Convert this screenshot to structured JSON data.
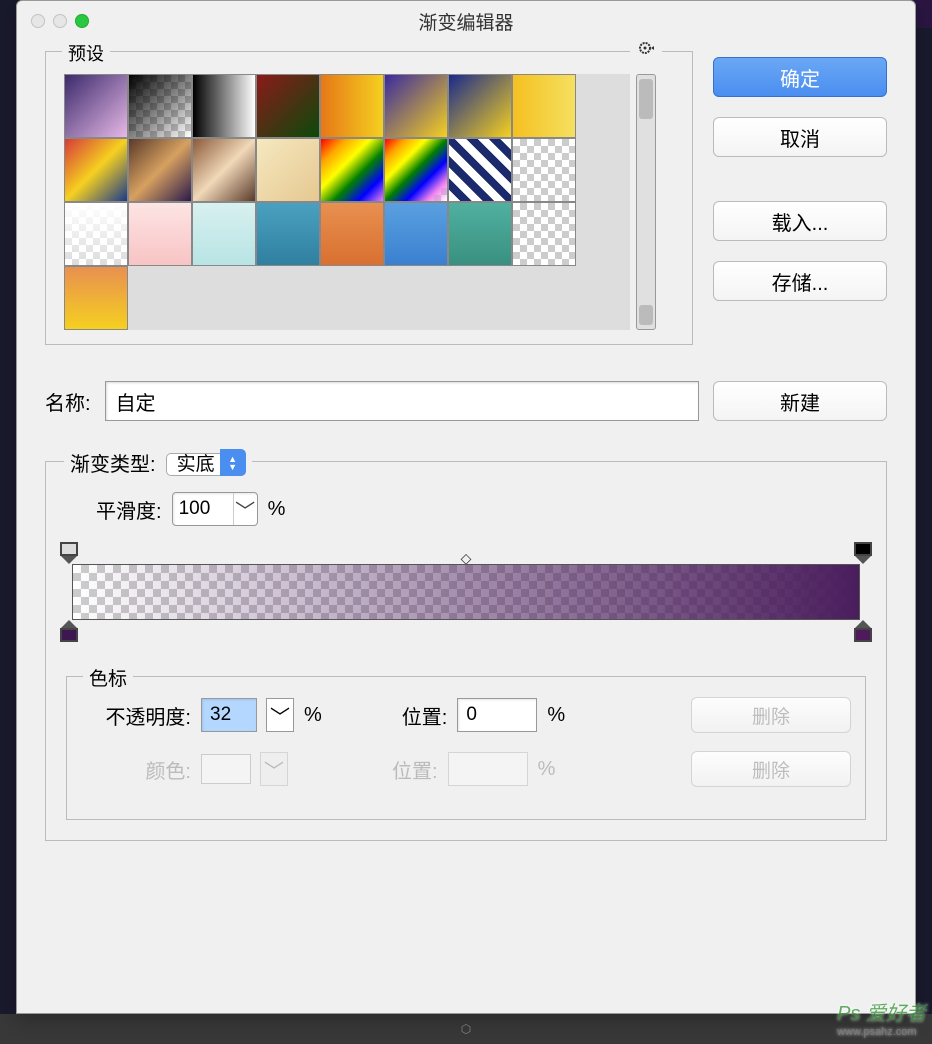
{
  "window": {
    "title": "渐变编辑器"
  },
  "presets": {
    "label": "预设"
  },
  "buttons": {
    "ok": "确定",
    "cancel": "取消",
    "load": "载入...",
    "save": "存储...",
    "new": "新建"
  },
  "name": {
    "label": "名称:",
    "value": "自定"
  },
  "gradient_type": {
    "label": "渐变类型:",
    "value": "实底"
  },
  "smoothness": {
    "label": "平滑度:",
    "value": "100",
    "unit": "%"
  },
  "stops": {
    "label": "色标",
    "opacity": {
      "label": "不透明度:",
      "value": "32",
      "unit": "%"
    },
    "position1": {
      "label": "位置:",
      "value": "0",
      "unit": "%"
    },
    "delete1": "删除",
    "color": {
      "label": "颜色:"
    },
    "position2": {
      "label": "位置:",
      "value": "",
      "unit": "%"
    },
    "delete2": "删除"
  },
  "gradient_stops": {
    "opacity_left": 0,
    "opacity_right": 100,
    "color_left": "#3d1850",
    "color_right": "#4f1a5c"
  },
  "watermark": {
    "main": "Ps 爱好者",
    "sub": "www.psahz.com"
  }
}
